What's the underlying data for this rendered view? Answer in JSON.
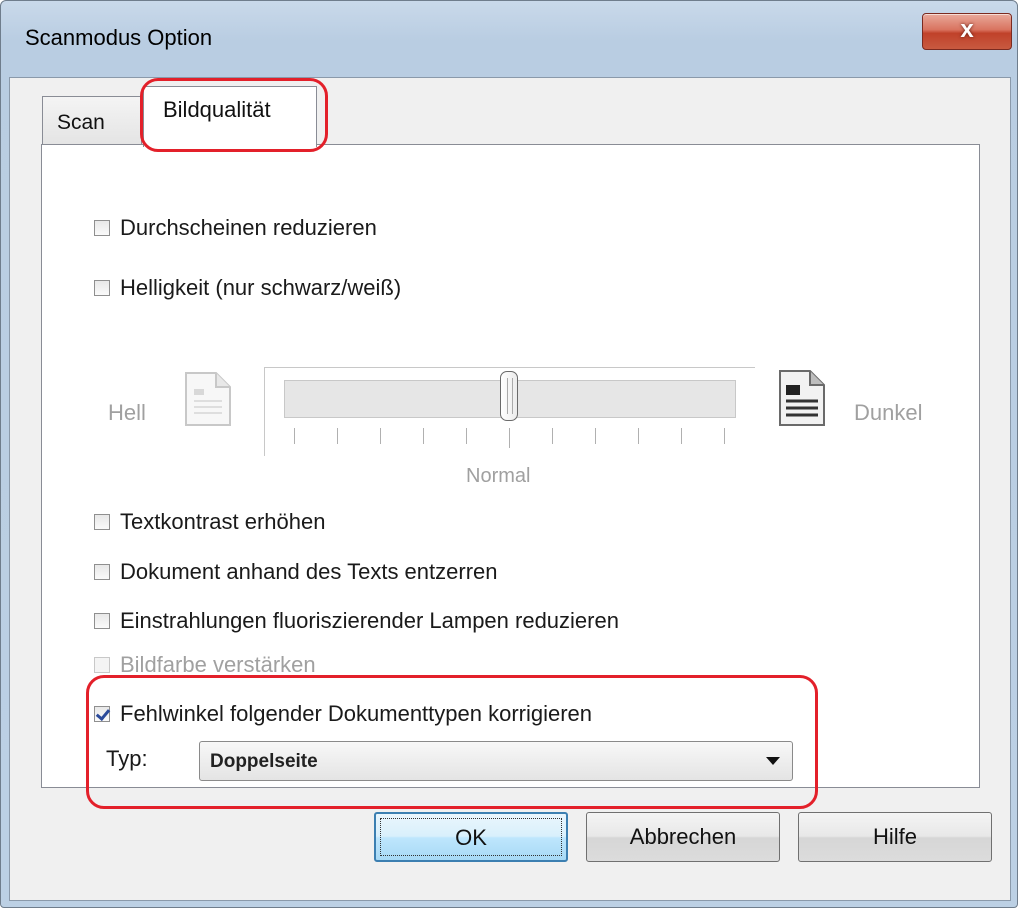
{
  "window": {
    "title": "Scanmodus Option",
    "close_glyph": "x"
  },
  "tabs": [
    {
      "label": "Scan",
      "active": false
    },
    {
      "label": "Bildqualität",
      "active": true
    }
  ],
  "options": {
    "durchscheinen": {
      "label": "Durchscheinen reduzieren",
      "checked": false,
      "enabled": true
    },
    "helligkeit": {
      "label": "Helligkeit (nur schwarz/weiß)",
      "checked": false,
      "enabled": true
    },
    "textkontrast": {
      "label": "Textkontrast erhöhen",
      "checked": false,
      "enabled": true
    },
    "entzerren": {
      "label": "Dokument anhand des Texts entzerren",
      "checked": false,
      "enabled": true
    },
    "lampen": {
      "label": "Einstrahlungen fluoriszierender Lampen reduzieren",
      "checked": false,
      "enabled": true
    },
    "bildfarbe": {
      "label": "Bildfarbe verstärken",
      "checked": false,
      "enabled": false
    },
    "fehlwinkel": {
      "label": "Fehlwinkel folgender Dokumenttypen korrigieren",
      "checked": true,
      "enabled": true
    }
  },
  "brightness": {
    "left_label": "Hell",
    "right_label": "Dunkel",
    "center_label": "Normal",
    "level_fraction": 0.5,
    "tick_count": 11
  },
  "type_select": {
    "label": "Typ:",
    "value": "Doppelseite"
  },
  "buttons": {
    "ok": "OK",
    "cancel": "Abbrechen",
    "help": "Hilfe"
  },
  "colors": {
    "highlight": "#e3202a",
    "close_button": "#c8442c",
    "check": "#2a4a9a"
  },
  "icons": [
    "close-icon",
    "light-document-icon",
    "dark-document-icon",
    "dropdown-arrow-icon",
    "checkmark-icon"
  ]
}
